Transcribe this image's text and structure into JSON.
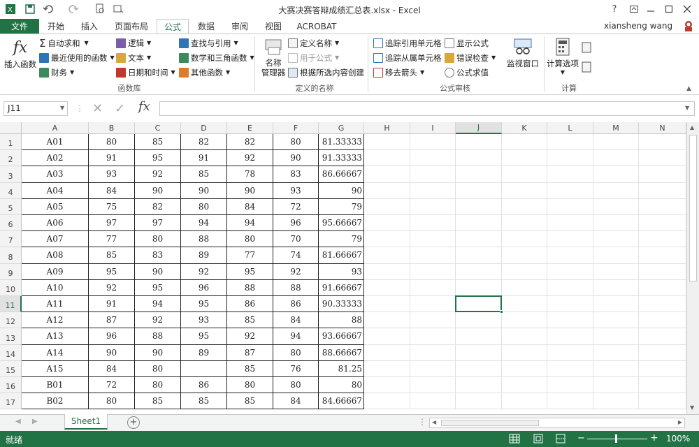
{
  "window": {
    "title": "大赛决赛答辩成绩汇总表.xlsx - Excel",
    "help": "?",
    "user": "xiansheng wang"
  },
  "tabs": [
    "文件",
    "开始",
    "插入",
    "页面布局",
    "公式",
    "数据",
    "审阅",
    "视图",
    "ACROBAT"
  ],
  "active_tab": "公式",
  "ribbon": {
    "insert_function": "插入函数",
    "autosum": "自动求和",
    "recent": "最近使用的函数",
    "finance": "财务",
    "logic": "逻辑",
    "text": "文本",
    "datetime": "日期和时间",
    "lookup": "查找与引用",
    "math": "数学和三角函数",
    "other": "其他函数",
    "group_library": "函数库",
    "name_manager_1": "名称",
    "name_manager_2": "管理器",
    "define_name": "定义名称",
    "use_in_formula": "用于公式",
    "create_from_sel": "根据所选内容创建",
    "group_names": "定义的名称",
    "trace_precedents": "追踪引用单元格",
    "trace_dependents": "追踪从属单元格",
    "remove_arrows": "移去箭头",
    "show_formulas": "显示公式",
    "error_check": "错误检查",
    "evaluate": "公式求值",
    "watch_window": "监视窗口",
    "group_audit": "公式审核",
    "calc_options": "计算选项",
    "group_calc": "计算"
  },
  "formula_bar": {
    "name_box": "J11",
    "fx": "fx",
    "formula": ""
  },
  "columns": [
    "A",
    "B",
    "C",
    "D",
    "E",
    "F",
    "G",
    "H",
    "I",
    "J",
    "K",
    "L",
    "M",
    "N"
  ],
  "rows": [
    {
      "n": "1",
      "cells": [
        "A01",
        "80",
        "85",
        "82",
        "82",
        "80",
        "81.33333"
      ]
    },
    {
      "n": "2",
      "cells": [
        "A02",
        "91",
        "95",
        "91",
        "92",
        "90",
        "91.33333"
      ]
    },
    {
      "n": "3",
      "cells": [
        "A03",
        "93",
        "92",
        "85",
        "78",
        "83",
        "86.66667"
      ]
    },
    {
      "n": "4",
      "cells": [
        "A04",
        "84",
        "90",
        "90",
        "90",
        "93",
        "90"
      ]
    },
    {
      "n": "5",
      "cells": [
        "A05",
        "75",
        "82",
        "80",
        "84",
        "72",
        "79"
      ]
    },
    {
      "n": "6",
      "cells": [
        "A06",
        "97",
        "97",
        "94",
        "94",
        "96",
        "95.66667"
      ]
    },
    {
      "n": "7",
      "cells": [
        "A07",
        "77",
        "80",
        "88",
        "80",
        "70",
        "79"
      ]
    },
    {
      "n": "8",
      "cells": [
        "A08",
        "85",
        "83",
        "89",
        "77",
        "74",
        "81.66667"
      ]
    },
    {
      "n": "9",
      "cells": [
        "A09",
        "95",
        "90",
        "92",
        "95",
        "92",
        "93"
      ]
    },
    {
      "n": "10",
      "cells": [
        "A10",
        "92",
        "95",
        "96",
        "88",
        "88",
        "91.66667"
      ]
    },
    {
      "n": "11",
      "cells": [
        "A11",
        "91",
        "94",
        "95",
        "86",
        "86",
        "90.33333"
      ]
    },
    {
      "n": "12",
      "cells": [
        "A12",
        "87",
        "92",
        "93",
        "85",
        "84",
        "88"
      ]
    },
    {
      "n": "13",
      "cells": [
        "A13",
        "96",
        "88",
        "95",
        "92",
        "94",
        "93.66667"
      ]
    },
    {
      "n": "14",
      "cells": [
        "A14",
        "90",
        "90",
        "89",
        "87",
        "80",
        "88.66667"
      ]
    },
    {
      "n": "15",
      "cells": [
        "A15",
        "84",
        "80",
        "",
        "85",
        "76",
        "81.25"
      ]
    },
    {
      "n": "16",
      "cells": [
        "B01",
        "72",
        "80",
        "86",
        "80",
        "80",
        "80"
      ]
    },
    {
      "n": "17",
      "cells": [
        "B02",
        "80",
        "85",
        "85",
        "85",
        "84",
        "84.66667"
      ]
    }
  ],
  "sheet": {
    "name": "Sheet1"
  },
  "status": {
    "ready": "就绪",
    "zoom": "100%"
  },
  "colors": {
    "accent": "#217346"
  }
}
